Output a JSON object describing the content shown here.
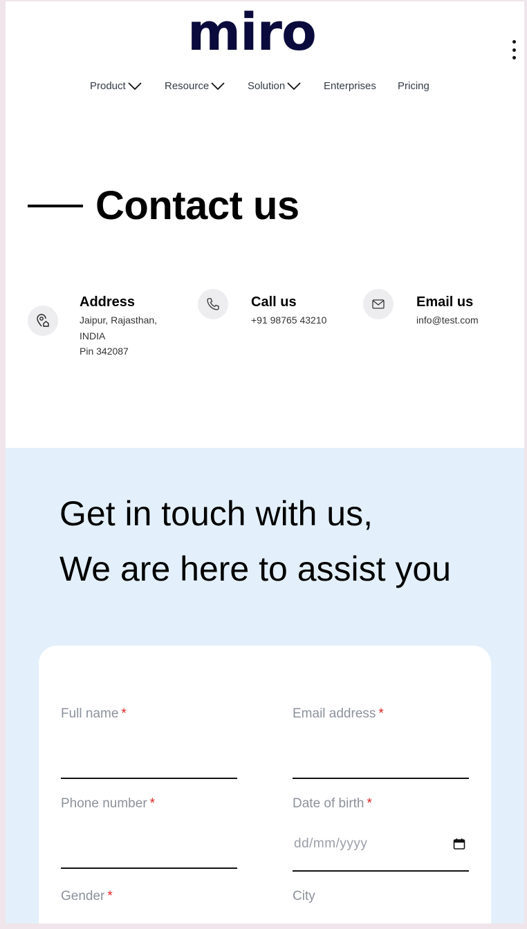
{
  "brand": {
    "logo_text": "miro"
  },
  "nav": {
    "items": [
      {
        "label": "Product",
        "has_dropdown": true
      },
      {
        "label": "Resource",
        "has_dropdown": true
      },
      {
        "label": "Solution",
        "has_dropdown": true
      },
      {
        "label": "Enterprises",
        "has_dropdown": false
      },
      {
        "label": "Pricing",
        "has_dropdown": false
      }
    ],
    "menu_icon": "kebab-menu-icon"
  },
  "contact": {
    "title": "Contact us",
    "address": {
      "heading": "Address",
      "line1": "Jaipur, Rajasthan,",
      "line2": "INDIA",
      "line3": "Pin 342087",
      "icon": "location-home-icon"
    },
    "call": {
      "heading": "Call us",
      "value": "+91 98765 43210",
      "icon": "phone-icon"
    },
    "email": {
      "heading": "Email us",
      "value": "info@test.com",
      "icon": "mail-icon"
    }
  },
  "hero": {
    "line1": "Get in touch with us,",
    "line2": "We are here to assist you"
  },
  "form": {
    "full_name": {
      "label": "Full name",
      "required_mark": "*",
      "value": ""
    },
    "email": {
      "label": "Email address",
      "required_mark": "*",
      "value": ""
    },
    "phone": {
      "label": "Phone number",
      "required_mark": "*",
      "value": ""
    },
    "dob": {
      "label": "Date of birth",
      "required_mark": "*",
      "placeholder": "dd/mm/yyyy"
    },
    "gender": {
      "label": "Gender",
      "required_mark": "*"
    },
    "city": {
      "label": "City"
    }
  },
  "colors": {
    "logo": "#0a0a3c",
    "section_bg": "#e3f0fb",
    "required": "#dd2222",
    "label": "#8c919b"
  }
}
